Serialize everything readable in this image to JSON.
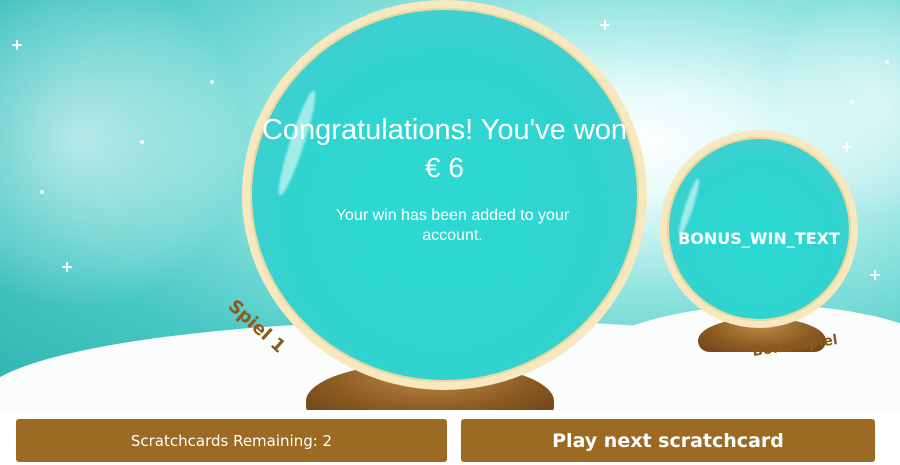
{
  "globe_main": {
    "title": "Congratulations! You've won",
    "amount": "€ 6",
    "subtitle": "Your win has been added to your account.",
    "label": "Spiel 1"
  },
  "globe_bonus": {
    "text": "BONUS_WIN_TEXT",
    "label": "Bonusspiel"
  },
  "footer": {
    "remaining_label": "Scratchcards Remaining: 2",
    "next_button": "Play next scratchcard"
  },
  "colors": {
    "globe_fill": "#2fd4cf",
    "globe_rim": "#f7e8bf",
    "button_bg": "#9c6a22",
    "label_text": "#8a5a1e"
  }
}
